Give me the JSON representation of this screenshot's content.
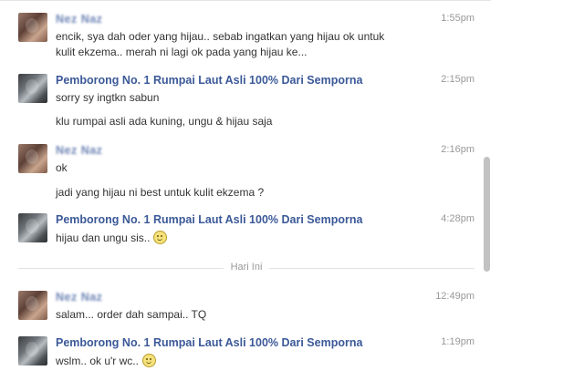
{
  "conversation": {
    "day_separator": "Hari Ini",
    "messages": [
      {
        "sender": "Nez Naz",
        "sender_redacted": true,
        "time": "1:55pm",
        "lines": [
          "encik, sya dah oder yang hijau.. sebab ingatkan yang hijau ok untuk",
          "kulit ekzema.. merah ni lagi ok pada yang hijau ke..."
        ]
      },
      {
        "sender": "Pemborong No. 1 Rumpai Laut Asli 100% Dari Semporna",
        "time": "2:15pm",
        "lines": [
          "sorry sy ingtkn sabun",
          "klu rumpai asli ada kuning, ungu & hijau saja"
        ]
      },
      {
        "sender": "Nez Naz",
        "sender_redacted": true,
        "time": "2:16pm",
        "lines": [
          "ok",
          "jadi yang hijau ni best untuk kulit ekzema ?"
        ]
      },
      {
        "sender": "Pemborong No. 1 Rumpai Laut Asli 100% Dari Semporna",
        "time": "4:28pm",
        "lines": [
          "hijau dan ungu sis.."
        ],
        "emoticon": "smiley-icon"
      },
      {
        "sender": "Nez Naz",
        "sender_redacted": true,
        "time": "12:49pm",
        "lines": [
          "salam... order dah sampai.. TQ"
        ]
      },
      {
        "sender": "Pemborong No. 1 Rumpai Laut Asli 100% Dari Semporna",
        "time": "1:19pm",
        "lines": [
          "wslm.. ok u'r wc.."
        ],
        "emoticon": "smiley-icon"
      }
    ]
  },
  "colors": {
    "sender_link": "#3b5998",
    "timestamp": "#999999",
    "body_text": "#333333",
    "scrollbar": "#c2c2c2"
  }
}
